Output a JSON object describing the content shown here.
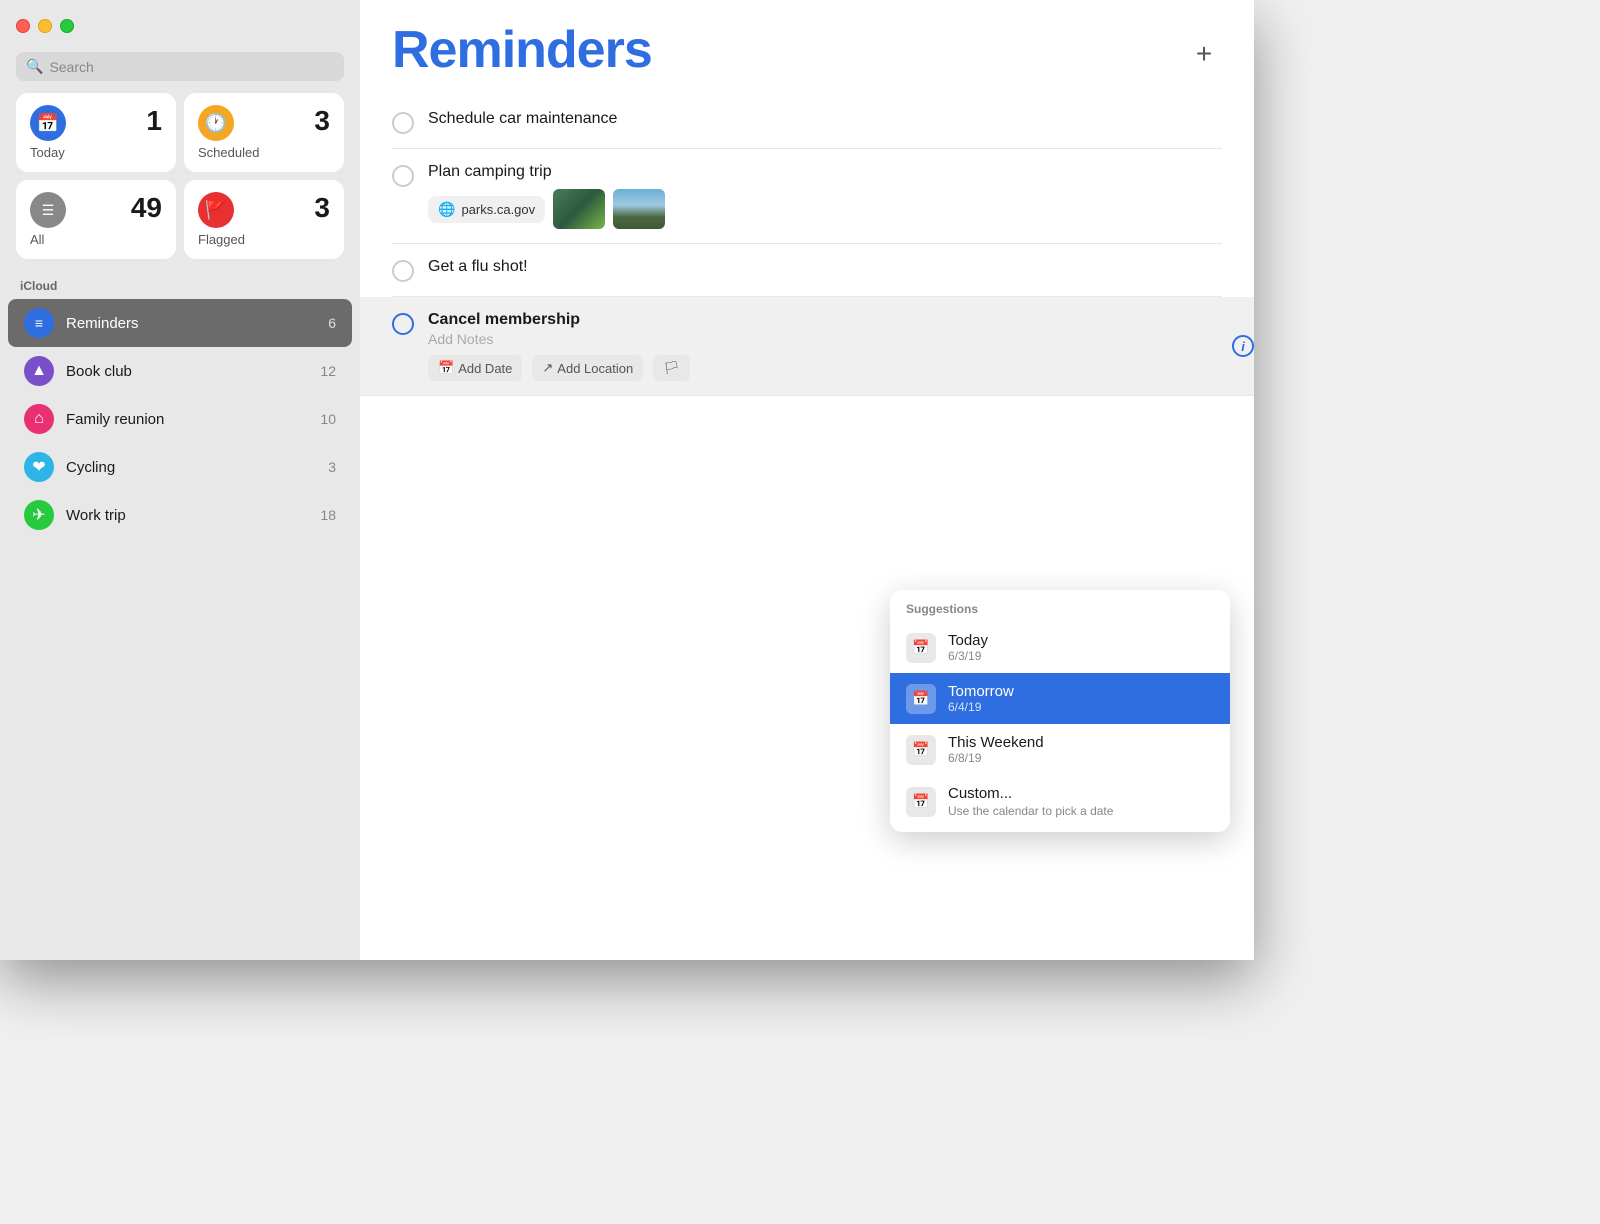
{
  "window": {
    "title": "Reminders"
  },
  "sidebar": {
    "search_placeholder": "Search",
    "smart_lists": [
      {
        "id": "today",
        "label": "Today",
        "count": "1",
        "icon_color": "#2e6ee1",
        "icon": "📅"
      },
      {
        "id": "scheduled",
        "label": "Scheduled",
        "count": "3",
        "icon_color": "#f5a623",
        "icon": "🕐"
      },
      {
        "id": "all",
        "label": "All",
        "count": "49",
        "icon_color": "#555",
        "icon": "☰"
      },
      {
        "id": "flagged",
        "label": "Flagged",
        "count": "3",
        "icon_color": "#e83030",
        "icon": "🚩"
      }
    ],
    "section_icloud": "iCloud",
    "lists": [
      {
        "id": "reminders",
        "name": "Reminders",
        "count": "6",
        "icon_color": "#2e6ee1",
        "icon": "≡",
        "active": true
      },
      {
        "id": "book-club",
        "name": "Book club",
        "count": "12",
        "icon_color": "#7b4fca",
        "icon": "▲"
      },
      {
        "id": "family-reunion",
        "name": "Family reunion",
        "count": "10",
        "icon_color": "#e83073",
        "icon": "⌂"
      },
      {
        "id": "cycling",
        "name": "Cycling",
        "count": "3",
        "icon_color": "#2eb5e8",
        "icon": "❤"
      },
      {
        "id": "work-trip",
        "name": "Work trip",
        "count": "18",
        "icon_color": "#27c93f",
        "icon": "✈"
      }
    ]
  },
  "main": {
    "title": "Reminders",
    "add_button": "+",
    "reminders": [
      {
        "id": "car-maintenance",
        "title": "Schedule car maintenance",
        "notes": "",
        "has_attachments": false,
        "selected": false
      },
      {
        "id": "camping-trip",
        "title": "Plan camping trip",
        "notes": "",
        "has_attachments": true,
        "link_text": "parks.ca.gov",
        "selected": false
      },
      {
        "id": "flu-shot",
        "title": "Get a flu shot!",
        "notes": "",
        "has_attachments": false,
        "selected": false
      },
      {
        "id": "cancel-membership",
        "title": "Cancel membership",
        "notes": "Add Notes",
        "has_attachments": false,
        "selected": true,
        "add_date_label": "Add Date",
        "add_location_label": "Add Location"
      }
    ],
    "date_dropdown": {
      "section_label": "Suggestions",
      "items": [
        {
          "id": "today",
          "title": "Today",
          "subtitle": "6/3/19",
          "highlighted": false
        },
        {
          "id": "tomorrow",
          "title": "Tomorrow",
          "subtitle": "6/4/19",
          "highlighted": true
        },
        {
          "id": "this-weekend",
          "title": "This Weekend",
          "subtitle": "6/8/19",
          "highlighted": false
        },
        {
          "id": "custom",
          "title": "Custom...",
          "subtitle": "Use the calendar to pick a date",
          "highlighted": false
        }
      ]
    }
  }
}
